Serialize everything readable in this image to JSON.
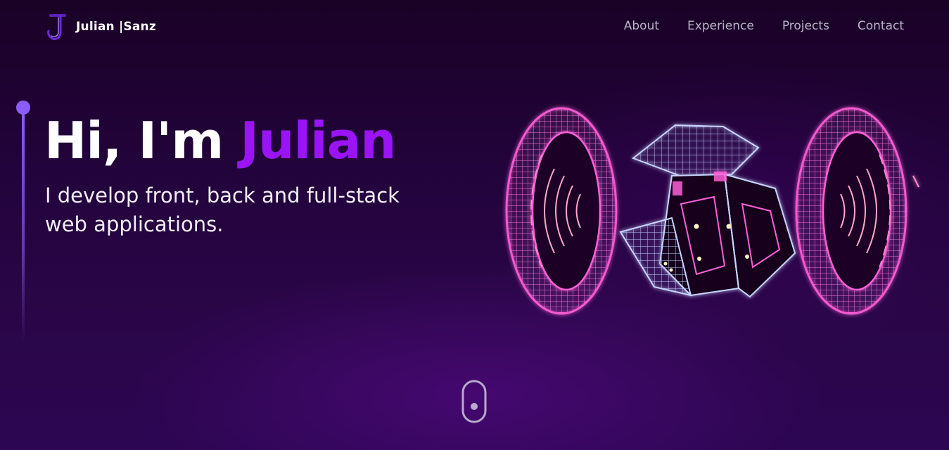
{
  "nav": {
    "logo_letter": "J",
    "logo_name": "Julian",
    "logo_separator": "|",
    "logo_surname": "Sanz",
    "links": [
      {
        "label": "About"
      },
      {
        "label": "Experience"
      },
      {
        "label": "Projects"
      },
      {
        "label": "Contact"
      }
    ]
  },
  "hero": {
    "greeting": "Hi, I'm",
    "name": "Julian",
    "subtitle": "I develop front, back and full-stack web applications."
  },
  "art": {
    "icon": "neon-wireframe-rings-icon"
  },
  "scroll": {
    "icon": "mouse-scroll-icon"
  },
  "colors": {
    "accent": "#9b14f7",
    "side_line": "#8b5cf6",
    "nav_text": "#b9b3c8",
    "ring_pink": "#ff5fd7",
    "wire_blue": "#b9c7ff"
  }
}
